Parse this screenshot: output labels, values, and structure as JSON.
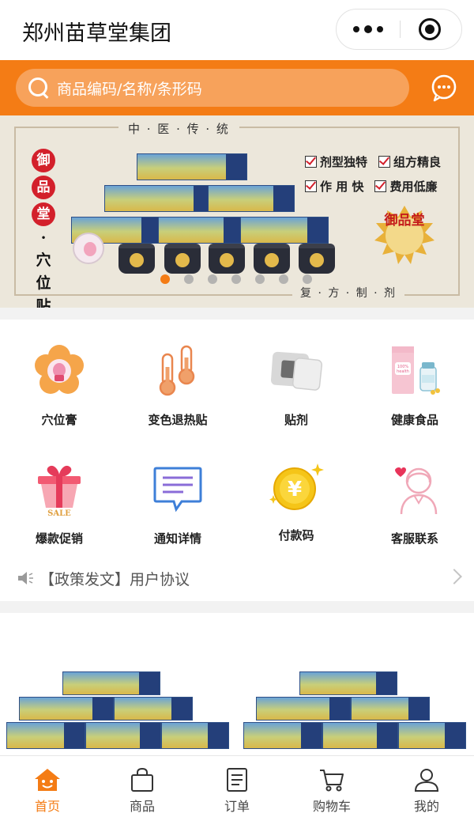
{
  "app": {
    "title": "郑州苗草堂集团"
  },
  "search": {
    "placeholder": "商品编码/名称/条形码"
  },
  "banner": {
    "top_text": "中 · 医 · 传 · 统",
    "bottom_text": "复 · 方 · 制 · 剂",
    "brand_chars": [
      "御",
      "品",
      "堂",
      "·",
      "穴",
      "位",
      "贴"
    ],
    "features": [
      "剂型独特",
      "组方精良",
      "作 用 快",
      "费用低廉"
    ],
    "seal_text": "御品堂",
    "slide_count": 7,
    "active_slide": 0
  },
  "menu": {
    "items": [
      {
        "label": "穴位膏",
        "icon": "flower-patch-icon"
      },
      {
        "label": "变色退热贴",
        "icon": "thermometer-icon"
      },
      {
        "label": "贴剂",
        "icon": "plaster-icon"
      },
      {
        "label": "健康食品",
        "icon": "health-food-icon"
      },
      {
        "label": "爆款促销",
        "icon": "sale-gift-icon"
      },
      {
        "label": "通知详情",
        "icon": "notice-message-icon"
      },
      {
        "label": "付款码",
        "icon": "payment-coin-icon"
      },
      {
        "label": "客服联系",
        "icon": "customer-service-icon"
      }
    ]
  },
  "notice": {
    "text": "【政策发文】用户协议"
  },
  "tabbar": {
    "items": [
      {
        "label": "首页",
        "icon": "home-icon",
        "active": true
      },
      {
        "label": "商品",
        "icon": "bag-icon",
        "active": false
      },
      {
        "label": "订单",
        "icon": "order-list-icon",
        "active": false
      },
      {
        "label": "购物车",
        "icon": "cart-icon",
        "active": false
      },
      {
        "label": "我的",
        "icon": "user-icon",
        "active": false
      }
    ]
  },
  "colors": {
    "accent": "#f47c15",
    "search_bg": "#f7a25b"
  }
}
